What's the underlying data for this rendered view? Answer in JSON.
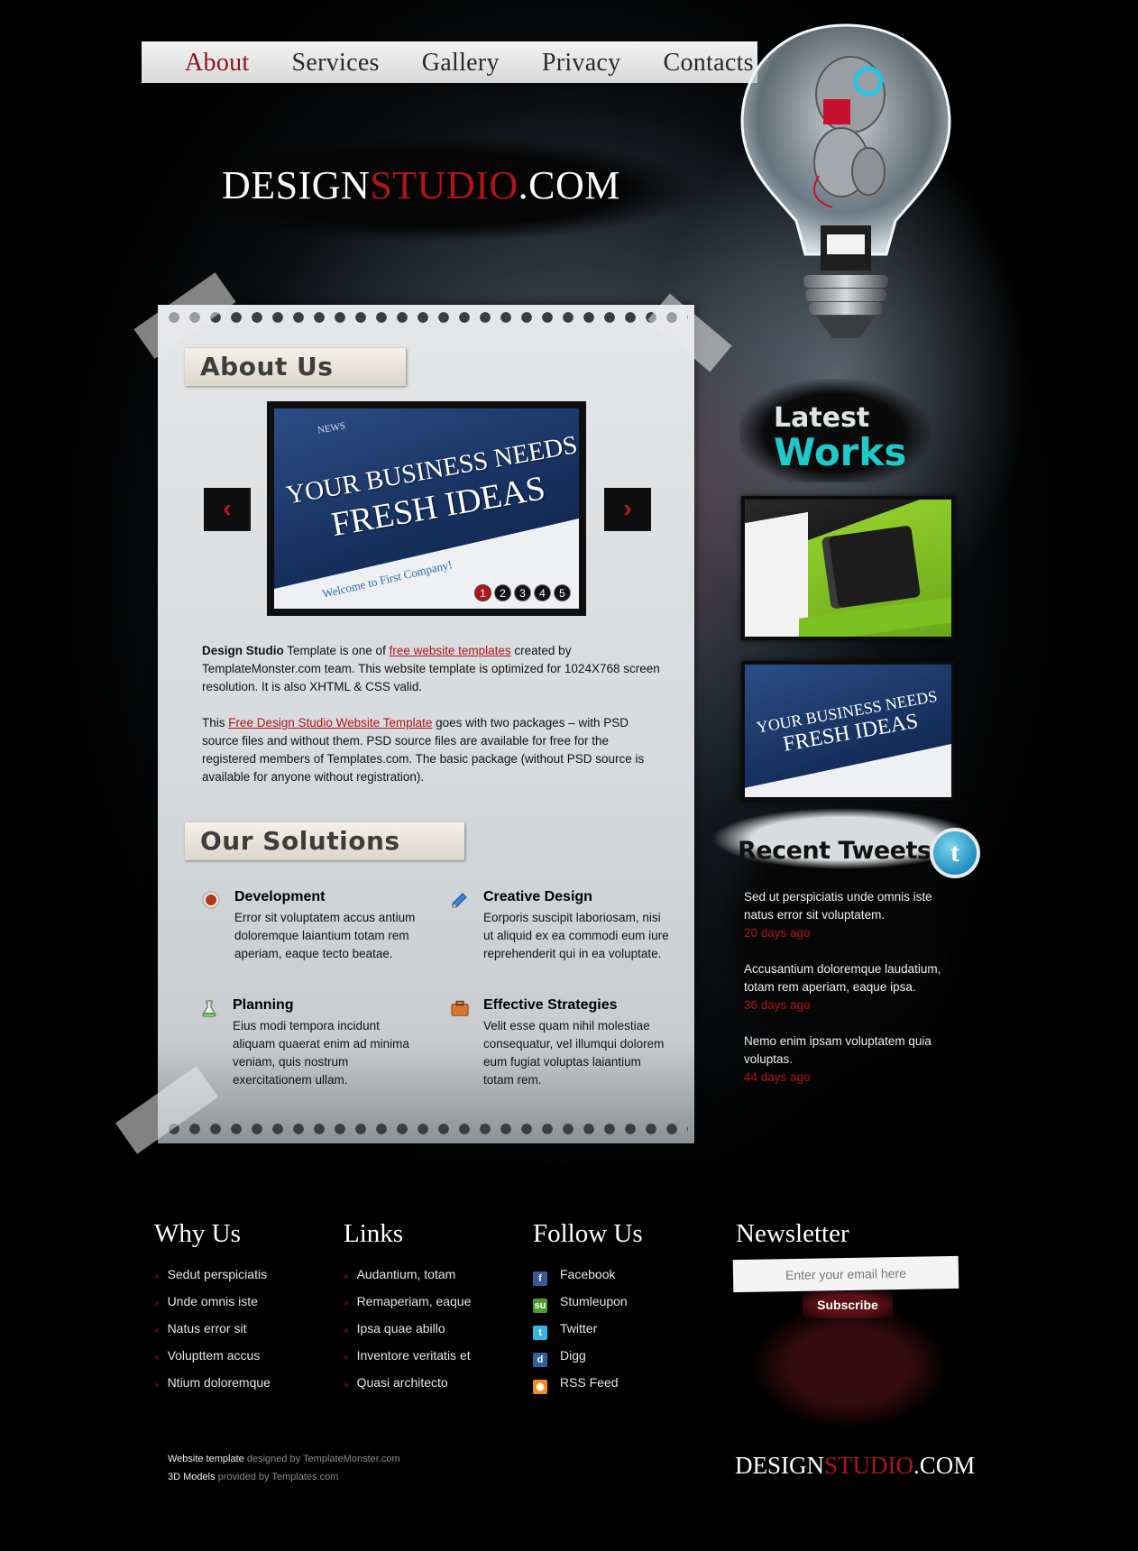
{
  "nav": {
    "items": [
      "About",
      "Services",
      "Gallery",
      "Privacy",
      "Contacts"
    ],
    "active_index": 0
  },
  "logo": {
    "part1": "DESIGN",
    "part2": "STUDIO",
    "part3": ".COM"
  },
  "about": {
    "heading": "About Us",
    "slider": {
      "tag": "NEWS",
      "headline_1": "YOUR BUSINESS NEEDS",
      "headline_2": "FRESH IDEAS",
      "strip_text": "Welcome to First Company!",
      "pages": [
        "1",
        "2",
        "3",
        "4",
        "5"
      ],
      "active_page": 0,
      "prev_icon": "chevron-left-icon",
      "next_icon": "chevron-right-icon"
    },
    "p1": {
      "bold": "Design Studio",
      "t1": " Template is one of ",
      "link": "free website templates",
      "t2": " created by TemplateMonster.com team. This website template is optimized for 1024X768 screen resolution. It is also XHTML & CSS valid."
    },
    "p2": {
      "t1": "This ",
      "link": "Free Design Studio Website Template",
      "t2": " goes with two packages – with PSD source files and without them. PSD source files are available for free for the registered members of Templates.com. The basic package (without PSD source is available for anyone without registration)."
    }
  },
  "solutions": {
    "heading": "Our Solutions",
    "items": [
      {
        "icon": "orb-icon",
        "title": "Development",
        "desc": "Error sit voluptatem accus antium doloremque laiantium totam rem aperiam, eaque tecto beatae."
      },
      {
        "icon": "pencil-icon",
        "title": "Creative Design",
        "desc": "Eorporis suscipit laboriosam, nisi ut aliquid ex ea commodi eum iure reprehenderit qui in ea voluptate."
      },
      {
        "icon": "flask-icon",
        "title": "Planning",
        "desc": "Eius modi tempora incidunt aliquam quaerat enim ad minima veniam, quis nostrum exercitationem ullam."
      },
      {
        "icon": "briefcase-icon",
        "title": "Effective Strategies",
        "desc": "Velit esse quam nihil molestiae consequatur, vel illumqui dolorem eum fugiat voluptas laiantium totam rem."
      }
    ]
  },
  "latest_works": {
    "line1": "Latest",
    "line2": "Works",
    "work2_headline_1": "YOUR BUSINESS NEEDS",
    "work2_headline_2": "FRESH IDEAS"
  },
  "tweets": {
    "heading": "Recent Tweets",
    "items": [
      {
        "text": "Sed ut perspiciatis unde omnis iste natus error sit voluptatem.",
        "when": "20 days ago"
      },
      {
        "text": "Accusantium doloremque laudatium, totam rem aperiam, eaque ipsa.",
        "when": "36 days ago"
      },
      {
        "text": "Nemo enim ipsam voluptatem quia voluptas.",
        "when": "44 days ago"
      }
    ]
  },
  "footer": {
    "why_us": {
      "heading": "Why Us",
      "items": [
        "Sedut perspiciatis",
        "Unde omnis iste",
        "Natus error sit",
        "Volupttem accus",
        "Ntium doloremque"
      ]
    },
    "links": {
      "heading": "Links",
      "items": [
        "Audantium, totam",
        "Remaperiam, eaque",
        "Ipsa quae abillo",
        "Inventore veritatis et",
        "Quasi architecto"
      ]
    },
    "follow_us": {
      "heading": "Follow Us",
      "items": [
        {
          "label": "Facebook",
          "icon": "facebook-icon",
          "color": "#3b5998"
        },
        {
          "label": "Stumleupon",
          "icon": "stumbleupon-icon",
          "color": "#4a9e2f"
        },
        {
          "label": "Twitter",
          "icon": "twitter-icon",
          "color": "#33b6e6"
        },
        {
          "label": "Digg",
          "icon": "digg-icon",
          "color": "#2f5f9c"
        },
        {
          "label": "RSS Feed",
          "icon": "rss-icon",
          "color": "#f08a1c"
        }
      ]
    },
    "newsletter": {
      "heading": "Newsletter",
      "placeholder": "Enter your email here",
      "button": "Subscribe"
    },
    "credits": {
      "line1_bold": "Website template",
      "line1_rest": " designed by ",
      "line1_link": "TemplateMonster.com",
      "line2_bold": "3D Models",
      "line2_rest": " provided by ",
      "line2_link": "Templates.com"
    },
    "logo": {
      "part1": "DESIGN",
      "part2": "STUDIO",
      "part3": ".COM"
    }
  },
  "colors": {
    "accent": "#b0141a",
    "teal": "#1fc9c9",
    "paper": "#dcdfe1"
  }
}
